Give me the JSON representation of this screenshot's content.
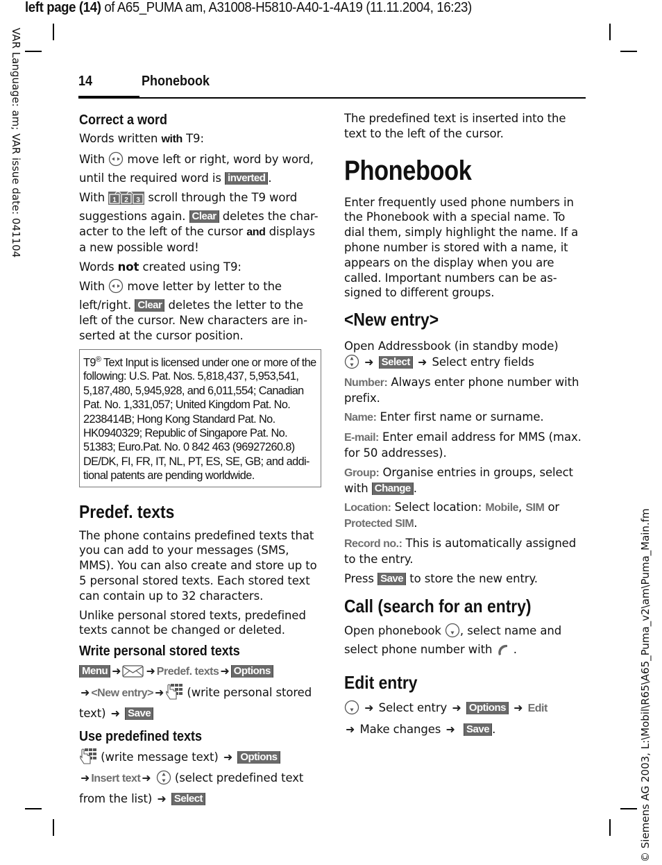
{
  "print_header": {
    "bold_part": "left page (14)",
    "rest": " of A65_PUMA am, A31008-H5810-A40-1-4A19 (11.11.2004, 16:23)"
  },
  "side_left_text": "VAR Language: am; VAR issue date: 041104",
  "side_right_text": "© Siemens AG 2003, L:\\Mobil\\R65\\A65_Puma_v2\\am\\Puma_Main.fm",
  "running_header": {
    "page_number": "14",
    "title": "Phonebook"
  },
  "icons": {
    "nav_left_right": "navigation-key-left-right-icon",
    "keys_123": "keys-1-2-3-icon",
    "envelope": "envelope-icon",
    "keypad_hand": "keypad-hand-icon",
    "nav_up_down": "navigation-key-up-down-icon",
    "nav_down": "navigation-key-down-icon",
    "call_key": "call-key-icon",
    "arrow": "→"
  },
  "left_column": {
    "correct_word": {
      "heading": "Correct a word",
      "t9_line": {
        "pre": "Words written ",
        "bold": "with",
        "post": " T9:"
      },
      "p1": {
        "pre": "With",
        "post": " move left or right, word by word, until the required word is ",
        "key": "inverted",
        "end": "."
      },
      "p2": {
        "pre": "With",
        "post": " scroll through the T9 word suggestions again. ",
        "key": "Clear",
        "mid": " deletes the char-acter to the left of the cursor ",
        "bold": "and",
        "end": " displays a new possible word!"
      },
      "not_t9_line": {
        "pre": "Words ",
        "bold": "not",
        "post": " created using T9:"
      },
      "p3": {
        "pre": "With",
        "post": " move letter by letter to the left/right. ",
        "key": "Clear",
        "end": " deletes the letter to the left of the cursor. New characters are in-serted at the cursor position."
      }
    },
    "patent_box": {
      "t9": "T9",
      "reg": "®",
      "text": " Text Input is licensed under one or more of the following: U.S. Pat. Nos. 5,818,437, 5,953,541, 5,187,480, 5,945,928, and 6,011,554; Canadian Pat. No. 1,331,057; United Kingdom Pat. No. 2238414B; Hong Kong Standard Pat. No. HK0940329; Republic of Singapore Pat. No. 51383; Euro.Pat. No. 0 842 463 (96927260.8) DE/DK, FI, FR, IT, NL, PT, ES, SE, GB; and addi-tional patents are pending worldwide."
    },
    "predef": {
      "heading": "Predef. texts",
      "p1": "The phone contains predefined texts that you can add to your messages (SMS, MMS). You can also create and store up to 5 personal stored texts. Each stored text can contain up to 32 characters.",
      "p2": "Unlike personal stored texts, predefined texts cannot be changed or deleted.",
      "write": {
        "heading": "Write personal stored texts",
        "menu_key": "Menu",
        "predef_label": "Predef. texts",
        "options_key": "Options",
        "new_entry_label": "<New entry>",
        "write_note": " (write personal stored text) ",
        "save_key": "Save"
      },
      "use": {
        "heading": "Use predefined texts",
        "write_note": " (write message text) ",
        "options_key": "Options",
        "insert_label": "Insert text",
        "select_note": " (select predefined text from the list) ",
        "select_key": "Select"
      }
    }
  },
  "right_column": {
    "insert_note": "The predefined text is inserted into the text to the left of the cursor.",
    "phonebook": {
      "heading": "Phonebook",
      "intro": "Enter frequently used phone numbers in the Phonebook with a special name. To dial them, simply highlight the name. If a phone number is stored with a name, it appears on the display when you are called. Important numbers can be as-signed to different groups."
    },
    "new_entry": {
      "heading": "<New entry>",
      "open": "Open Addressbook (in standby mode)",
      "select_key": "Select",
      "select_fields": " Select entry fields",
      "fields": [
        {
          "label": "Number:",
          "text": " Always enter phone number with prefix."
        },
        {
          "label": "Name:",
          "text": " Enter first name or surname."
        },
        {
          "label": "E-mail:",
          "text": " Enter email address for MMS (max. for 50 addresses)."
        }
      ],
      "group": {
        "label": "Group:",
        "text": " Organise entries in groups, select with ",
        "key": "Change",
        "end": "."
      },
      "location": {
        "label": "Location:",
        "text": " Select location: ",
        "opt1": "Mobile",
        "sep": ", ",
        "opt2": "SIM",
        "or": " or ",
        "opt3": "Protected SIM",
        "end": "."
      },
      "record": {
        "label": "Record no.:",
        "text": " This is automatically assigned to the entry."
      },
      "press": {
        "pre": "Press ",
        "key": "Save",
        "post": " to store the new entry."
      }
    },
    "call": {
      "heading": "Call (search for an entry)",
      "pre": "Open phonebook ",
      "mid": ", select name and select phone number with ",
      "end": " ."
    },
    "edit": {
      "heading": "Edit entry",
      "select_entry": " Select entry ",
      "options_key": "Options",
      "edit_label": "Edit",
      "make_changes": " Make changes ",
      "save_key": "Save",
      "end": "."
    }
  }
}
